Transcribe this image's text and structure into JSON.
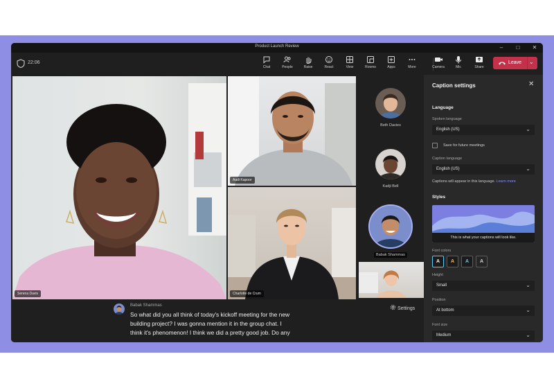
{
  "window": {
    "title": "Product Launch Review"
  },
  "toolbar": {
    "timer": "22:06",
    "items": [
      {
        "label": "Chat",
        "icon": "chat-icon"
      },
      {
        "label": "People",
        "icon": "people-icon"
      },
      {
        "label": "Raise",
        "icon": "raise-hand-icon"
      },
      {
        "label": "React",
        "icon": "react-icon"
      },
      {
        "label": "View",
        "icon": "view-icon"
      },
      {
        "label": "Rooms",
        "icon": "rooms-icon"
      },
      {
        "label": "Apps",
        "icon": "apps-icon"
      },
      {
        "label": "More",
        "icon": "more-icon"
      }
    ],
    "devices": [
      {
        "label": "Camera",
        "icon": "camera-icon"
      },
      {
        "label": "Mic",
        "icon": "mic-icon"
      },
      {
        "label": "Share",
        "icon": "share-icon"
      }
    ],
    "leave_label": "Leave"
  },
  "participants": {
    "main": "Serena Davis",
    "grid": [
      "Aadi Kapoor",
      "Charlotte de Crum"
    ],
    "roster": [
      "Beth Davies",
      "Kadji Bell",
      "Babak Shammas"
    ]
  },
  "captions": {
    "speaker": "Babak Shammas",
    "lines": [
      "So what did you all think of today's kickoff meeting for the new",
      "building project? I was gonna mention it in the group chat. I",
      "think it's phenomenon! I think we did a pretty good job. Do any"
    ],
    "settings_label": "Settings"
  },
  "panel": {
    "title": "Caption settings",
    "language_section": "Language",
    "spoken_label": "Spoken language",
    "spoken_value": "English (US)",
    "save_checkbox": "Save for future meetings",
    "caption_label": "Caption language",
    "caption_value": "English (US)",
    "help_text": "Captions will appear in this language.",
    "learn_more": "Learn more",
    "styles_section": "Styles",
    "preview_text": "This is what your captions will look like.",
    "font_colors_label": "Font colors",
    "font_colors": [
      {
        "letter": "A",
        "fg": "#f5f5f5",
        "bg": "#1b1b1b"
      },
      {
        "letter": "A",
        "fg": "#f7b25b",
        "bg": "#1b1b1b"
      },
      {
        "letter": "A",
        "fg": "#5ec9f5",
        "bg": "#1b1b1b"
      },
      {
        "letter": "A",
        "fg": "#1a1a1a",
        "bg": "#d8d8d8"
      }
    ],
    "height_label": "Height",
    "height_value": "Small",
    "position_label": "Position",
    "position_value": "At bottom",
    "font_size_label": "Font size",
    "font_size_value": "Medium"
  },
  "colors": {
    "leave": "#c4314b",
    "accent": "#8b8df0",
    "frame": "#8e8fe4"
  }
}
